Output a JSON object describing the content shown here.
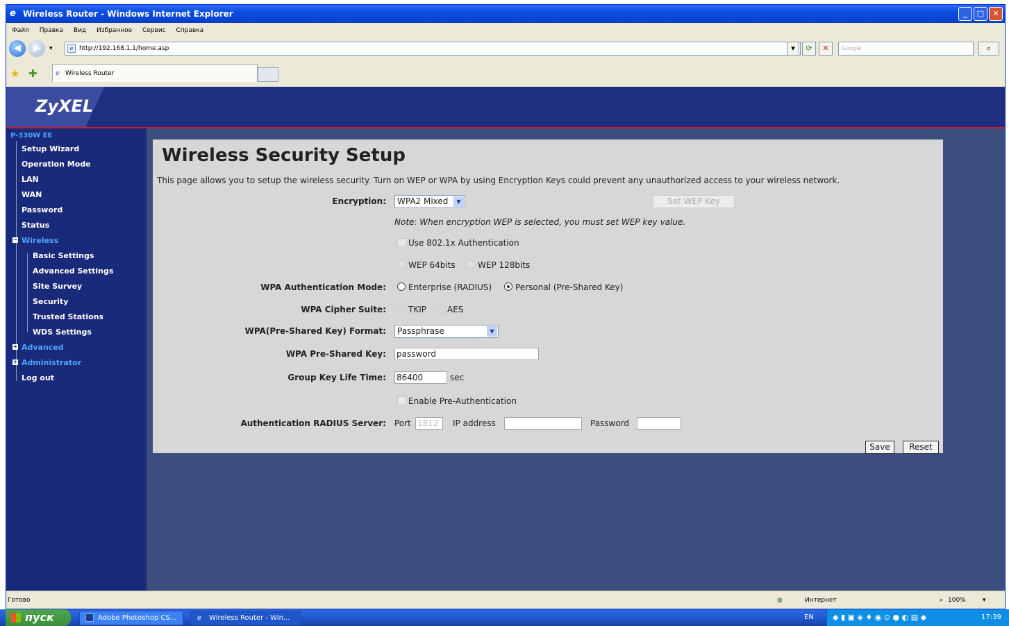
{
  "window": {
    "title": "Wireless Router - Windows Internet Explorer",
    "min": "_",
    "max": "□",
    "close": "✕"
  },
  "menu": [
    "Файл",
    "Правка",
    "Вид",
    "Избранное",
    "Сервис",
    "Справка"
  ],
  "address": {
    "url": "http://192.168.1.1/home.asp",
    "search_placeholder": "Google"
  },
  "tab": {
    "title": "Wireless Router"
  },
  "router": {
    "brand": "ZyXEL",
    "model": "P-330W EE",
    "nav": [
      "Setup Wizard",
      "Operation Mode",
      "LAN",
      "WAN",
      "Password",
      "Status",
      "Wireless",
      "Basic Settings",
      "Advanced Settings",
      "Site Survey",
      "Security",
      "Trusted Stations",
      "WDS Settings",
      "Advanced",
      "Administrator",
      "Log out"
    ]
  },
  "page": {
    "title": "Wireless Security Setup",
    "description": "This page allows you to setup the wireless security. Turn on WEP or WPA by using Encryption Keys could prevent any unauthorized access to your wireless network.",
    "encryption_label": "Encryption:",
    "encryption_value": "WPA2 Mixed",
    "set_wep_key": "Set WEP Key",
    "note": "Note: When encryption WEP is selected, you must set WEP key value.",
    "use_8021x": "Use 802.1x Authentication",
    "wep64": "WEP 64bits",
    "wep128": "WEP 128bits",
    "auth_mode_label": "WPA Authentication Mode:",
    "auth_enterprise": "Enterprise (RADIUS)",
    "auth_personal": "Personal (Pre-Shared Key)",
    "cipher_label": "WPA Cipher Suite:",
    "cipher_tkip": "TKIP",
    "cipher_aes": "AES",
    "psk_format_label": "WPA(Pre-Shared Key) Format:",
    "psk_format_value": "Passphrase",
    "psk_label": "WPA Pre-Shared Key:",
    "psk_value": "password",
    "gk_label": "Group Key Life Time:",
    "gk_value": "86400",
    "gk_unit": "sec",
    "preauth": "Enable Pre-Authentication",
    "radius_label": "Authentication RADIUS Server:",
    "radius_port_label": "Port",
    "radius_port_value": "1812",
    "radius_ip_label": "IP address",
    "radius_pw_label": "Password",
    "save": "Save",
    "reset": "Reset"
  },
  "statusbar": {
    "left": "Готово",
    "zone": "Интернет",
    "zoom": "100%"
  },
  "taskbar": {
    "start": "пуск",
    "tasks": [
      "Adobe Photoshop CS...",
      "Wireless Router - Win..."
    ],
    "lang": "EN",
    "clock": "17:39"
  }
}
